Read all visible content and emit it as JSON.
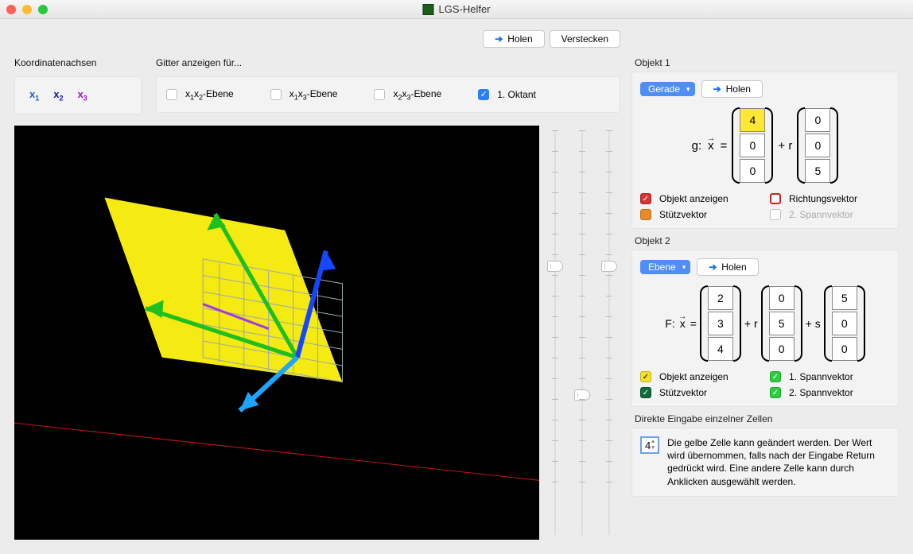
{
  "window": {
    "title": "LGS-Helfer"
  },
  "topButtons": {
    "holen": "Holen",
    "verstecken": "Verstecken"
  },
  "axes": {
    "heading": "Koordinatenachsen",
    "x1": "x",
    "x1s": "1",
    "x2": "x",
    "x2s": "2",
    "x3": "x",
    "x3s": "3"
  },
  "grids": {
    "heading": "Gitter anzeigen für...",
    "p1a": "x",
    "p1b": "1",
    "p1c": "x",
    "p1d": "2",
    "p1e": "-Ebene",
    "p2a": "x",
    "p2b": "1",
    "p2c": "x",
    "p2d": "3",
    "p2e": "-Ebene",
    "p3a": "x",
    "p3b": "2",
    "p3c": "x",
    "p3d": "3",
    "p3e": "-Ebene",
    "oct": "1. Oktant"
  },
  "obj1": {
    "title": "Objekt 1",
    "type": "Gerade",
    "holen": "Holen",
    "prefix": "g:",
    "x": "x",
    "eq": "=",
    "plusr": "+ r",
    "vA": [
      "4",
      "0",
      "0"
    ],
    "vB": [
      "0",
      "0",
      "5"
    ],
    "c1": "Objekt anzeigen",
    "c2": "Richtungsvektor",
    "c3": "Stützvektor",
    "c4": "2. Spannvektor"
  },
  "obj2": {
    "title": "Objekt 2",
    "type": "Ebene",
    "holen": "Holen",
    "prefix": "F:",
    "x": "x",
    "eq": "=",
    "plusr": "+ r",
    "pluss": "+ s",
    "vA": [
      "2",
      "3",
      "4"
    ],
    "vB": [
      "0",
      "5",
      "0"
    ],
    "vC": [
      "5",
      "0",
      "0"
    ],
    "c1": "Objekt anzeigen",
    "c2": "1. Spannvektor",
    "c3": "Stützvektor",
    "c4": "2. Spannvektor"
  },
  "direct": {
    "title": "Direkte Eingabe einzelner Zellen",
    "value": "4",
    "help": "Die gelbe Zelle kann geändert werden. Der Wert wird übernommen, falls nach der Eingabe Return gedrückt wird. Eine andere Zelle kann durch Anklicken ausgewählt werden."
  }
}
